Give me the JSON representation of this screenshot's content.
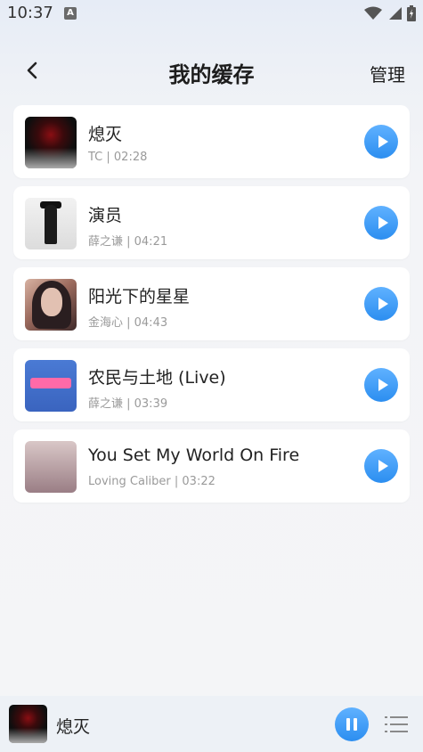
{
  "status": {
    "time": "10:37",
    "notification_badge": "A"
  },
  "header": {
    "title": "我的缓存",
    "manage_label": "管理"
  },
  "songs": [
    {
      "title": "熄灭",
      "meta": "TC | 02:28"
    },
    {
      "title": "演员",
      "meta": "薛之谦 | 04:21"
    },
    {
      "title": "阳光下的星星",
      "meta": "金海心 | 04:43"
    },
    {
      "title": "农民与土地 (Live)",
      "meta": "薛之谦 | 03:39"
    },
    {
      "title": "You Set My World On Fire",
      "meta": "Loving Caliber | 03:22"
    }
  ],
  "player": {
    "now_playing": "熄灭"
  },
  "colors": {
    "accent": "#3a97f5",
    "card_bg": "#ffffff",
    "meta_text": "#9a9a9a"
  },
  "icons": {
    "back": "chevron-left-icon",
    "play": "play-icon",
    "pause": "pause-icon",
    "playlist": "playlist-icon",
    "wifi": "wifi-icon",
    "signal": "signal-icon",
    "battery": "battery-icon"
  }
}
